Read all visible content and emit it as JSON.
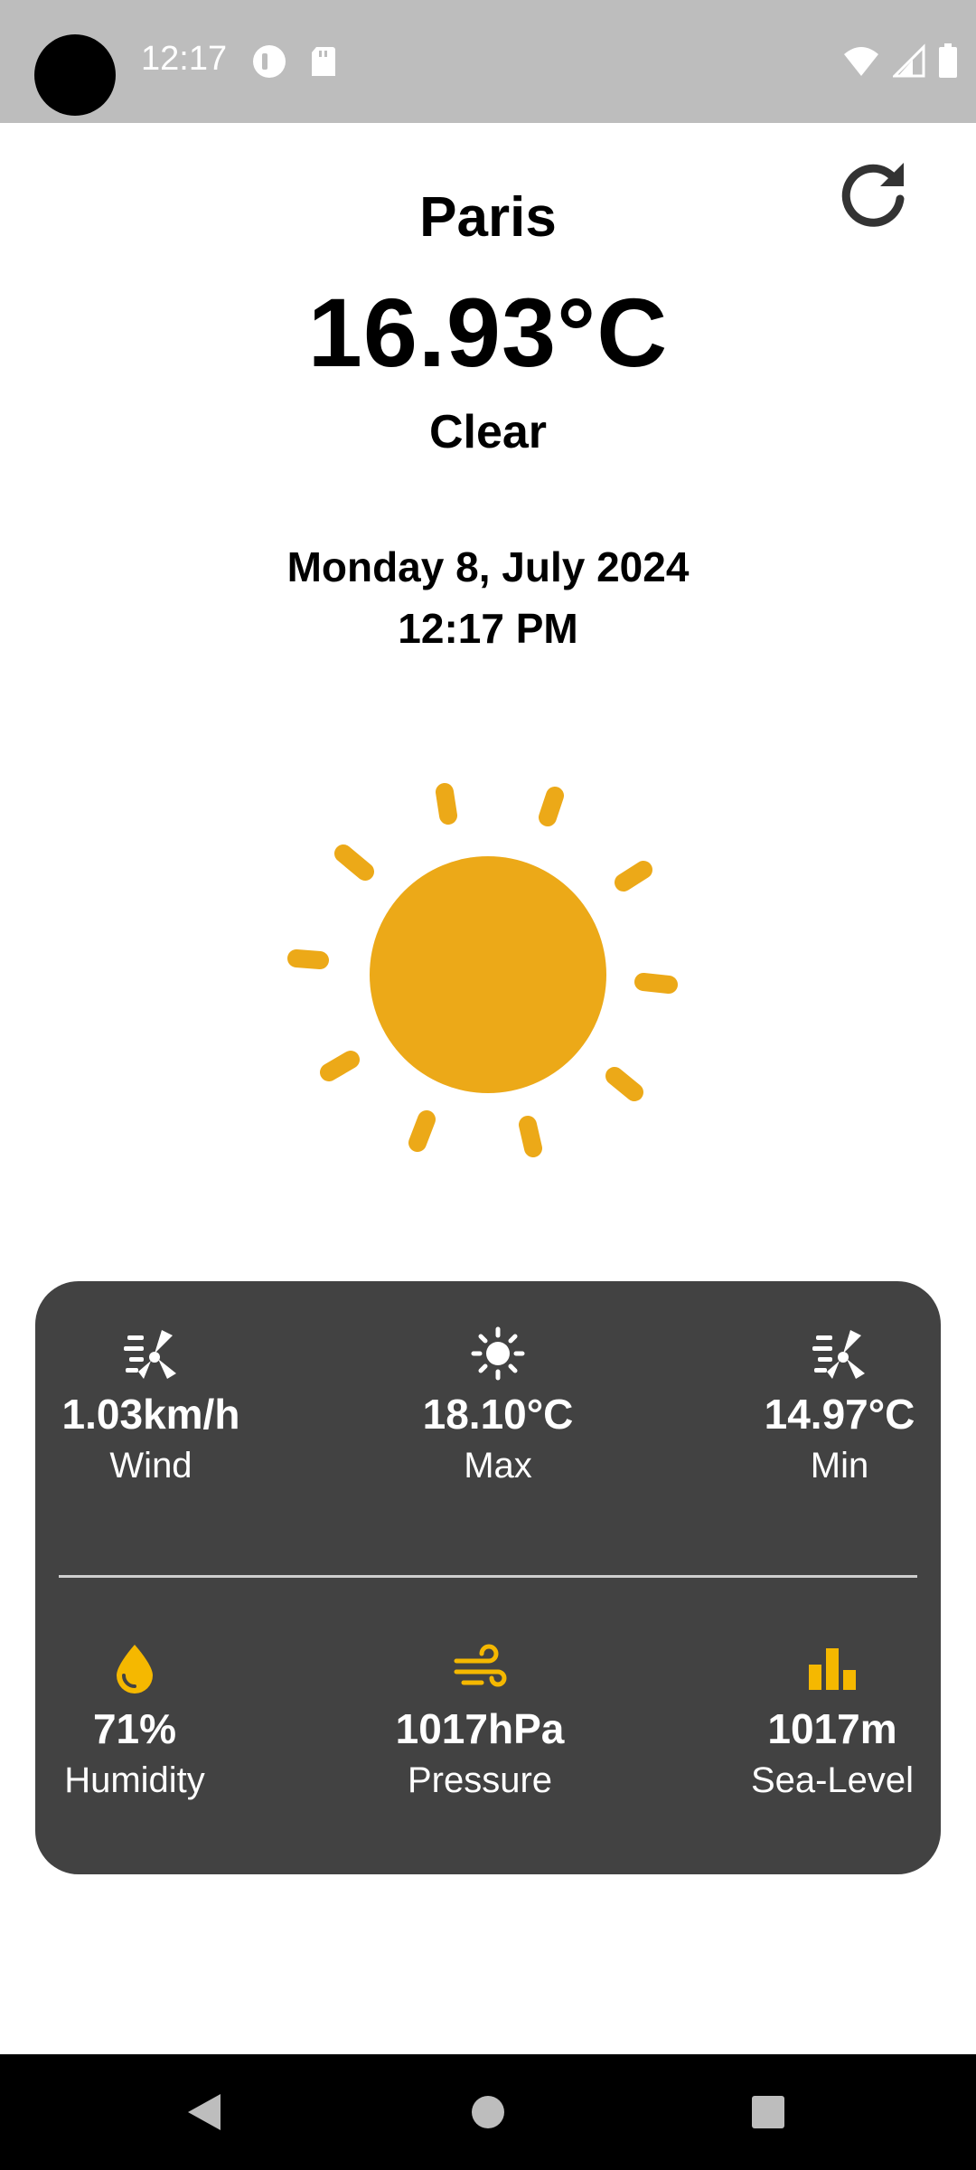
{
  "status_bar": {
    "time": "12:17",
    "icons": [
      "camera-cutout",
      "data-saver-icon",
      "sd-card-icon",
      "wifi-icon",
      "signal-icon",
      "battery-icon"
    ]
  },
  "weather": {
    "city": "Paris",
    "temperature": "16.93°C",
    "condition": "Clear",
    "date": "Monday 8, July 2024",
    "time": "12:17 PM",
    "icon": "sun-icon"
  },
  "details": {
    "wind": {
      "value": "1.03km/h",
      "label": "Wind",
      "icon": "wind-turbine-icon"
    },
    "max": {
      "value": "18.10°C",
      "label": "Max",
      "icon": "sun-small-icon"
    },
    "min": {
      "value": "14.97°C",
      "label": "Min",
      "icon": "wind-turbine-icon"
    },
    "humidity": {
      "value": "71%",
      "label": "Humidity",
      "icon": "water-drop-icon"
    },
    "pressure": {
      "value": "1017hPa",
      "label": "Pressure",
      "icon": "air-wind-icon"
    },
    "sea_level": {
      "value": "1017m",
      "label": "Sea-Level",
      "icon": "bar-chart-icon"
    }
  },
  "colors": {
    "status_bar": "#bdbdbd",
    "sun": "#eca918",
    "card": "#424242",
    "accent_yellow": "#f5b800"
  },
  "nav_bar": {
    "buttons": [
      "back-icon",
      "home-icon",
      "recents-icon"
    ]
  }
}
